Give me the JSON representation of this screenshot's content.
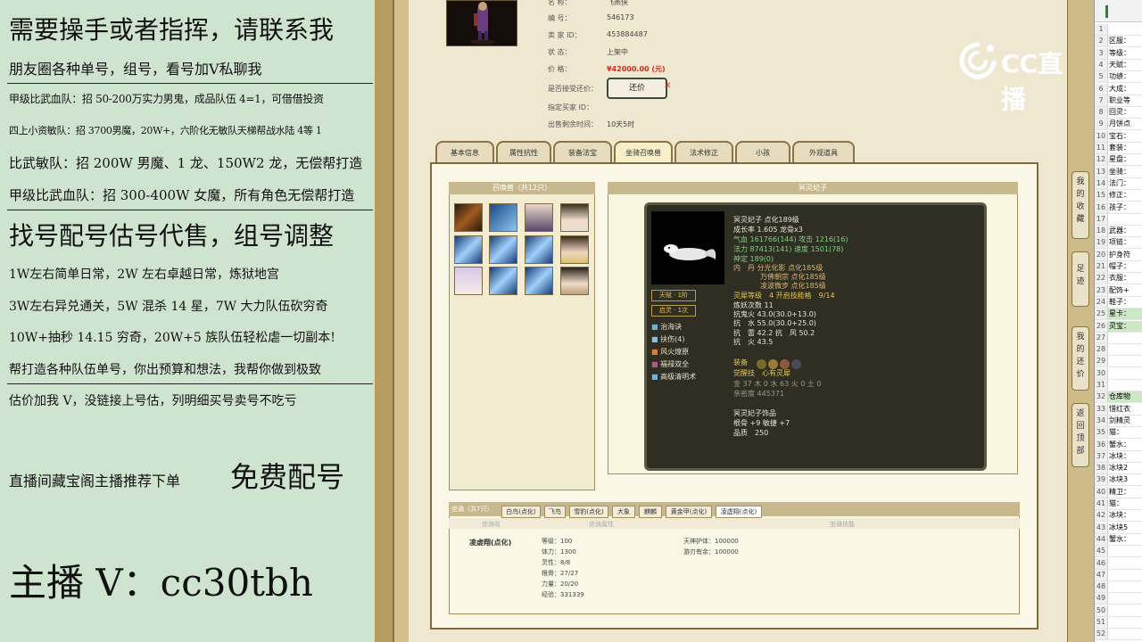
{
  "promo": {
    "lines": [
      "需要操手或者指挥，请联系我",
      "朋友圈各种单号，组号，看号加Ⅴ私聊我",
      "甲级比武血队：招 50-200万实力男鬼，成品队伍 4=1，可借借投资",
      "四上小资敏队：招 3700男魔，20W+，六阶化无敏队天梯帮战水陆 4等 1",
      "比武敏队：招 200W 男魔、1 龙、150W2 龙，无偿帮打造",
      "甲级比武血队：招 300-400W 女魔，所有角色无偿帮打造",
      "找号配号估号代售，组号调整",
      "1W左右简单日常，2W 左右卓越日常，炼狱地宫",
      "3W左右异兑通关，5W 混杀 14 星，7W 大力队伍砍穷奇",
      "10W+抽秒 14.15 穷奇，20W+5 族队伍轻松虐一切副本!",
      "帮打造各种队伍单号，你出预算和想法，我帮你做到极致",
      "估价加我 V，没链接上号估，列明细买号卖号不吃亏",
      "直播间藏宝阁主播推荐下单",
      "免费配号",
      "主播 V：cc30tbh"
    ]
  },
  "listing": {
    "fields": [
      {
        "label": "名        称：",
        "value": "飞燕侠"
      },
      {
        "label": "编        号：",
        "value": "546173"
      },
      {
        "label": "卖  家  ID：",
        "value": "453884487"
      },
      {
        "label": "状        态：",
        "value": "上架中"
      },
      {
        "label": "价        格：",
        "value": "¥42000.00 (元)"
      },
      {
        "label": "是否接受还价：",
        "value": ""
      },
      {
        "label": "指定买家 ID：",
        "value": ""
      },
      {
        "label": "出售剩余时间：",
        "value": "10天5时"
      }
    ],
    "bargain_button": "还价",
    "price_color": "#d22b1e"
  },
  "tabs": [
    "基本信息",
    "属性抗性",
    "装备法宝",
    "坐骑召唤兽",
    "法术修正",
    "小孩",
    "外观道具"
  ],
  "active_tab": 3,
  "pet_list": {
    "title": "召唤兽（共12只）"
  },
  "pet_detail": {
    "header": "冥灵妃子",
    "lines": [
      {
        "text": "冥灵妃子 点化189级",
        "color": "#e9e4cf"
      },
      {
        "text": "成长率 1.605 龙骨x3",
        "color": "#e9e4cf"
      },
      {
        "text": "气血 161766(144) 攻击 1216(16)",
        "color": "#7fd07f"
      },
      {
        "text": "法力 87413(141) 速度 1501(78)",
        "color": "#7fd07f"
      },
      {
        "text": "神定 189(0)",
        "color": "#7fd07f"
      },
      {
        "text": "内　丹 分光化影 点化185级",
        "color": "#d6b872"
      },
      {
        "text": "万佛朝宗 点化185级",
        "color": "#d6b872"
      },
      {
        "text": "凌波微步 点化185级",
        "color": "#d6b872"
      },
      {
        "text": "灵犀等级　4 开启技能格　9/14",
        "color": "#e6c34a"
      },
      {
        "text": "炼妖次数 11",
        "color": "#e9e4cf"
      },
      {
        "text": "抗鬼火 43.0(30.0+13.0)",
        "color": "#e9e4cf"
      },
      {
        "text": "抗　水 55.0(30.0+25.0)",
        "color": "#e9e4cf"
      },
      {
        "text": "抗　雷 42.2 抗　风 50.2",
        "color": "#e9e4cf"
      },
      {
        "text": "抗　火 43.5",
        "color": "#e9e4cf"
      },
      {
        "text": "装备",
        "color": "#e6c34a"
      },
      {
        "text": "觉醒技　心有灵犀",
        "color": "#e6c34a"
      },
      {
        "text": "金 37 木 0 水 63 火 0 土 0",
        "color": "#9a9a8a"
      },
      {
        "text": "亲密度 445371",
        "color": "#9a9a8a"
      },
      {
        "text": "冥灵妃子饰品",
        "color": "#e9e4cf"
      },
      {
        "text": "根骨 +9 敏捷 +7",
        "color": "#e9e4cf"
      },
      {
        "text": "品质　250",
        "color": "#e9e4cf"
      }
    ],
    "badges": [
      "天赋 · 1阶",
      "启灵 · 1次"
    ],
    "skills": [
      "治海诀",
      "扶伤(4)",
      "风火燎原",
      "福禄双全",
      "高级清明术"
    ]
  },
  "mounts": {
    "tabs": [
      "坐骑（共7只）",
      "白鸟(点化)",
      "飞鸟",
      "雪豹(点化)",
      "大象",
      "麒麟",
      "黄金甲(点化)",
      "凌虚翔(点化)"
    ],
    "columns": [
      "坐骑名",
      "坐骑属性",
      "坐骑技能"
    ],
    "name": "凌虚翔(点化)",
    "stats": [
      "等级：100",
      "体力：1300",
      "灵性：8/8",
      "根骨：27/27",
      "力量：20/20",
      "经验：331339"
    ],
    "skills": [
      "天神护体：100000",
      "游刃有余：100000"
    ]
  },
  "side_buttons": [
    "我的收藏",
    "足迹",
    "我的还价",
    "返回顶部"
  ],
  "watermark": "CC直播",
  "sheet": {
    "rows": [
      {
        "n": "1",
        "t": ""
      },
      {
        "n": "2",
        "t": "区服："
      },
      {
        "n": "3",
        "t": "等级："
      },
      {
        "n": "4",
        "t": "天赋："
      },
      {
        "n": "5",
        "t": "功绩："
      },
      {
        "n": "6",
        "t": "大成："
      },
      {
        "n": "7",
        "t": "职业等"
      },
      {
        "n": "8",
        "t": "回灵："
      },
      {
        "n": "9",
        "t": "月饼点"
      },
      {
        "n": "10",
        "t": "宝石："
      },
      {
        "n": "11",
        "t": "套装："
      },
      {
        "n": "12",
        "t": "星盘："
      },
      {
        "n": "13",
        "t": "坐骑："
      },
      {
        "n": "14",
        "t": "法门："
      },
      {
        "n": "15",
        "t": "修正："
      },
      {
        "n": "16",
        "t": "孩子："
      },
      {
        "n": "17",
        "t": ""
      },
      {
        "n": "18",
        "t": "武器："
      },
      {
        "n": "19",
        "t": "项链："
      },
      {
        "n": "20",
        "t": "护身符"
      },
      {
        "n": "21",
        "t": "帽子："
      },
      {
        "n": "22",
        "t": "衣服："
      },
      {
        "n": "23",
        "t": "配饰+"
      },
      {
        "n": "24",
        "t": "鞋子："
      },
      {
        "n": "25",
        "t": "星卡："
      },
      {
        "n": "26",
        "t": "灵宝："
      },
      {
        "n": "27",
        "t": ""
      },
      {
        "n": "28",
        "t": ""
      },
      {
        "n": "29",
        "t": ""
      },
      {
        "n": "30",
        "t": ""
      },
      {
        "n": "31",
        "t": ""
      },
      {
        "n": "32",
        "t": "仓库物"
      },
      {
        "n": "33",
        "t": "惜红衣"
      },
      {
        "n": "34",
        "t": "剑精灵"
      },
      {
        "n": "35",
        "t": "猫："
      },
      {
        "n": "36",
        "t": "蟹水："
      },
      {
        "n": "37",
        "t": "冰块："
      },
      {
        "n": "38",
        "t": "冰块2"
      },
      {
        "n": "39",
        "t": "冰块3"
      },
      {
        "n": "40",
        "t": "精卫："
      },
      {
        "n": "41",
        "t": "猫："
      },
      {
        "n": "42",
        "t": "冰块："
      },
      {
        "n": "43",
        "t": "冰块5"
      },
      {
        "n": "44",
        "t": "蟹水："
      },
      {
        "n": "45",
        "t": ""
      },
      {
        "n": "46",
        "t": ""
      },
      {
        "n": "47",
        "t": ""
      },
      {
        "n": "48",
        "t": ""
      },
      {
        "n": "49",
        "t": ""
      },
      {
        "n": "50",
        "t": ""
      },
      {
        "n": "51",
        "t": ""
      },
      {
        "n": "52",
        "t": ""
      }
    ]
  }
}
